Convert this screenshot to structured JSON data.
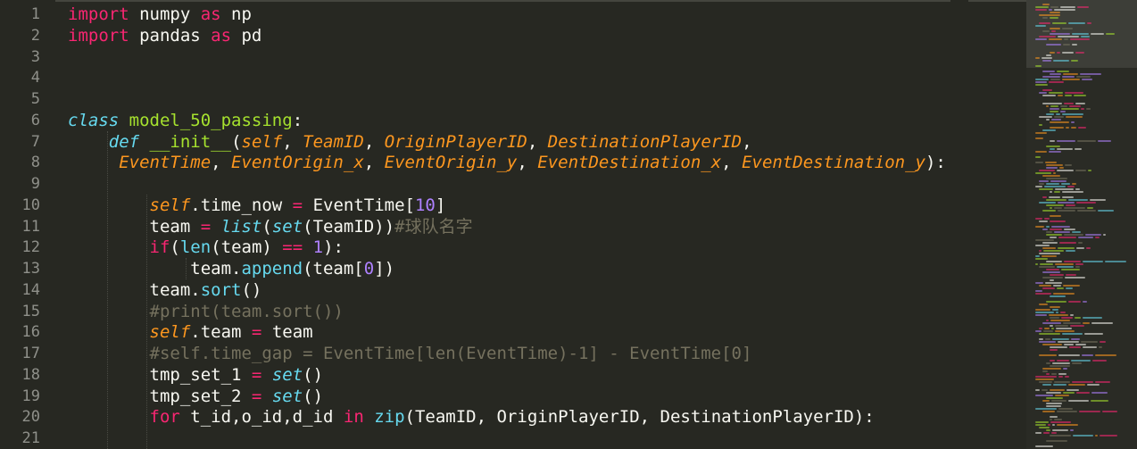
{
  "editor": {
    "line_numbers": [
      "1",
      "2",
      "3",
      "4",
      "5",
      "6",
      "7",
      "8",
      "9",
      "10",
      "11",
      "12",
      "13",
      "14",
      "15",
      "16",
      "17",
      "18",
      "19",
      "20",
      "21"
    ],
    "lines": [
      [
        {
          "t": "import",
          "c": "kw"
        },
        {
          "t": " numpy "
        },
        {
          "t": "as",
          "c": "kw"
        },
        {
          "t": " np"
        }
      ],
      [
        {
          "t": "import",
          "c": "kw"
        },
        {
          "t": " pandas "
        },
        {
          "t": "as",
          "c": "kw"
        },
        {
          "t": " pd"
        }
      ],
      [],
      [],
      [],
      [
        {
          "t": "class",
          "c": "st"
        },
        {
          "t": " "
        },
        {
          "t": "model_50_passing",
          "c": "fn"
        },
        {
          "t": ":"
        }
      ],
      [
        {
          "t": "    "
        },
        {
          "t": "def",
          "c": "st"
        },
        {
          "t": " "
        },
        {
          "t": "__init__",
          "c": "fn"
        },
        {
          "t": "("
        },
        {
          "t": "self",
          "c": "par"
        },
        {
          "t": ", "
        },
        {
          "t": "TeamID",
          "c": "par"
        },
        {
          "t": ", "
        },
        {
          "t": "OriginPlayerID",
          "c": "par"
        },
        {
          "t": ", "
        },
        {
          "t": "DestinationPlayerID",
          "c": "par"
        },
        {
          "t": ","
        }
      ],
      [
        {
          "t": "     "
        },
        {
          "t": "EventTime",
          "c": "par"
        },
        {
          "t": ", "
        },
        {
          "t": "EventOrigin_x",
          "c": "par"
        },
        {
          "t": ", "
        },
        {
          "t": "EventOrigin_y",
          "c": "par"
        },
        {
          "t": ", "
        },
        {
          "t": "EventDestination_x",
          "c": "par"
        },
        {
          "t": ", "
        },
        {
          "t": "EventDestination_y",
          "c": "par"
        },
        {
          "t": "):"
        }
      ],
      [],
      [
        {
          "t": "        "
        },
        {
          "t": "self",
          "c": "par"
        },
        {
          "t": ".time_now "
        },
        {
          "t": "=",
          "c": "kw"
        },
        {
          "t": " EventTime["
        },
        {
          "t": "10",
          "c": "num"
        },
        {
          "t": "]"
        }
      ],
      [
        {
          "t": "        team "
        },
        {
          "t": "=",
          "c": "kw"
        },
        {
          "t": " "
        },
        {
          "t": "list",
          "c": "st"
        },
        {
          "t": "("
        },
        {
          "t": "set",
          "c": "st"
        },
        {
          "t": "(TeamID))"
        },
        {
          "t": "#球队名字",
          "c": "cmt"
        }
      ],
      [
        {
          "t": "        "
        },
        {
          "t": "if",
          "c": "kw"
        },
        {
          "t": "("
        },
        {
          "t": "len",
          "c": "bi"
        },
        {
          "t": "(team) "
        },
        {
          "t": "==",
          "c": "kw"
        },
        {
          "t": " "
        },
        {
          "t": "1",
          "c": "num"
        },
        {
          "t": "):"
        }
      ],
      [
        {
          "t": "            team."
        },
        {
          "t": "append",
          "c": "bi"
        },
        {
          "t": "(team["
        },
        {
          "t": "0",
          "c": "num"
        },
        {
          "t": "])"
        }
      ],
      [
        {
          "t": "        team."
        },
        {
          "t": "sort",
          "c": "bi"
        },
        {
          "t": "()"
        }
      ],
      [
        {
          "t": "        "
        },
        {
          "t": "#print(team.sort())",
          "c": "cmt"
        }
      ],
      [
        {
          "t": "        "
        },
        {
          "t": "self",
          "c": "par"
        },
        {
          "t": ".team "
        },
        {
          "t": "=",
          "c": "kw"
        },
        {
          "t": " team"
        }
      ],
      [
        {
          "t": "        "
        },
        {
          "t": "#self.time_gap = EventTime[len(EventTime)-1] - EventTime[0]",
          "c": "cmt"
        }
      ],
      [
        {
          "t": "        tmp_set_1 "
        },
        {
          "t": "=",
          "c": "kw"
        },
        {
          "t": " "
        },
        {
          "t": "set",
          "c": "st"
        },
        {
          "t": "()"
        }
      ],
      [
        {
          "t": "        tmp_set_2 "
        },
        {
          "t": "=",
          "c": "kw"
        },
        {
          "t": " "
        },
        {
          "t": "set",
          "c": "st"
        },
        {
          "t": "()"
        }
      ],
      [
        {
          "t": "        "
        },
        {
          "t": "for",
          "c": "kw"
        },
        {
          "t": " t_id,o_id,d_id "
        },
        {
          "t": "in",
          "c": "kw"
        },
        {
          "t": " "
        },
        {
          "t": "zip",
          "c": "bi"
        },
        {
          "t": "(TeamID, OriginPlayerID, DestinationPlayerID):"
        }
      ],
      []
    ]
  }
}
